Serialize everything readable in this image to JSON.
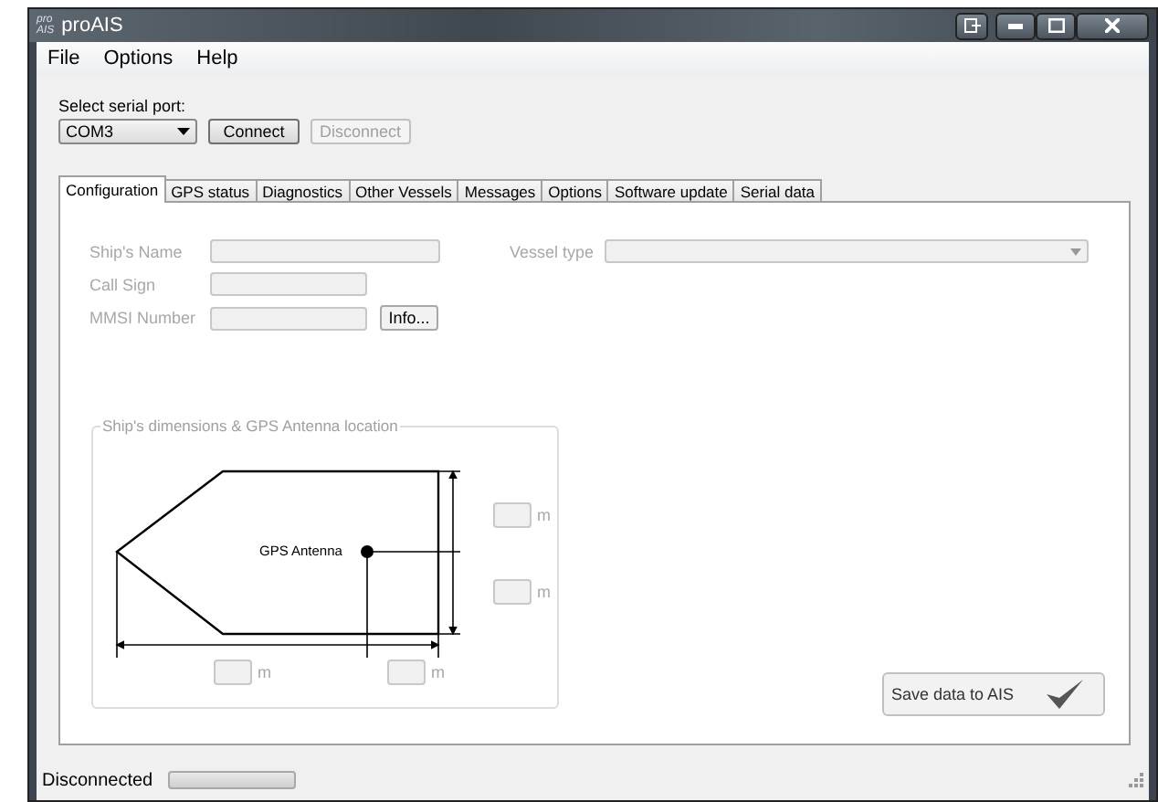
{
  "window": {
    "title": "proAIS",
    "logo_lines": [
      "pro",
      "AIS"
    ]
  },
  "menu": [
    "File",
    "Options",
    "Help"
  ],
  "serial": {
    "label": "Select serial port:",
    "port": "COM3",
    "buttons": [
      {
        "label": "Connect",
        "disabled": false
      },
      {
        "label": "Disconnect",
        "disabled": true
      }
    ]
  },
  "tabs": [
    {
      "label": "Configuration",
      "selected": true
    },
    {
      "label": "GPS status",
      "selected": false
    },
    {
      "label": "Diagnostics",
      "selected": false
    },
    {
      "label": "Other Vessels",
      "selected": false
    },
    {
      "label": "Messages",
      "selected": false
    },
    {
      "label": "Options",
      "selected": false
    },
    {
      "label": "Software update",
      "selected": false
    },
    {
      "label": "Serial data",
      "selected": false
    }
  ],
  "fields": [
    {
      "label": "Ship's Name",
      "kind": "wide",
      "disabled": true
    },
    {
      "label": "Call Sign",
      "kind": "short",
      "disabled": true
    },
    {
      "label": "MMSI Number",
      "kind": "info",
      "disabled": true,
      "button": "Info..."
    }
  ],
  "vessel_type": {
    "label": "Vessel type",
    "disabled": true
  },
  "dimensions": {
    "title": "Ship's dimensions & GPS Antenna location",
    "antenna_label": "GPS Antenna",
    "inputs": [
      {
        "unit": "m"
      },
      {
        "unit": "m"
      },
      {
        "unit": "m"
      },
      {
        "unit": "m"
      }
    ]
  },
  "save_button": {
    "label": "Save data to AIS"
  },
  "status_bar": {
    "text": "Disconnected",
    "progress": {
      "level": 0
    }
  }
}
